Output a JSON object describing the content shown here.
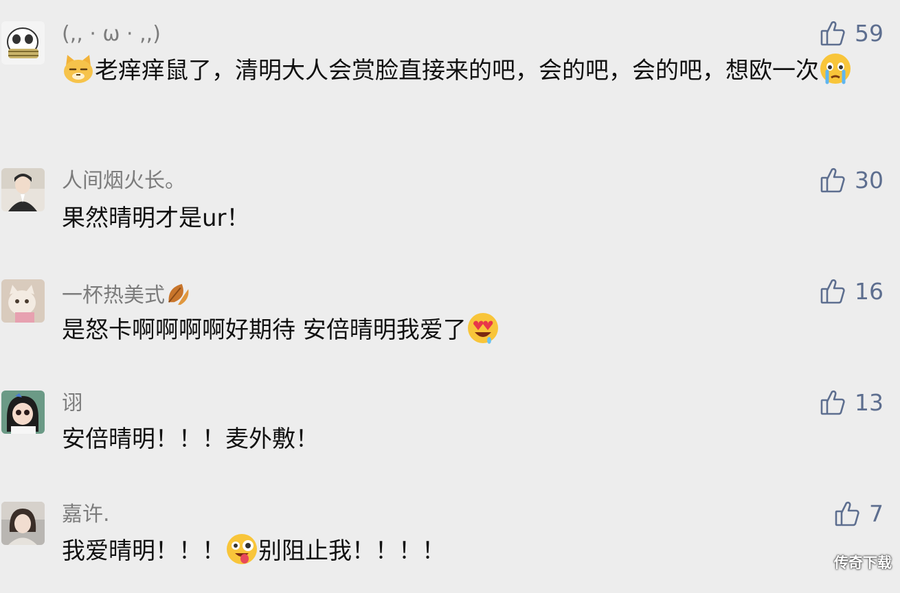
{
  "comments": [
    {
      "username": "(,, · ω · ,,)",
      "text_after_emoji": "老痒痒鼠了，清明大人会赏脸直接来的吧，会的吧，会的吧，想欧一次",
      "likes": "59",
      "leading_emoji": "cat-face-emoji",
      "trailing_emoji": "crying-face-emoji"
    },
    {
      "username": "人间烟火长。",
      "text": "果然晴明才是ur！",
      "likes": "30"
    },
    {
      "username": "一杯热美式",
      "username_emoji": "fallen-leaf-emoji",
      "text": "是怒卡啊啊啊啊好期待 安倍晴明我爱了",
      "likes": "16",
      "trailing_emoji": "heart-eyes-emoji"
    },
    {
      "username": "诩",
      "text": "安倍晴明！！！麦外敷！",
      "likes": "13"
    },
    {
      "username": "嘉许.",
      "text_before_emoji": "我爱晴明！！！",
      "text_after_emoji": "别阻止我！！！！",
      "likes": "7",
      "middle_emoji": "zany-face-emoji"
    }
  ],
  "watermark": "传奇下载",
  "colors": {
    "background": "#ededed",
    "username": "#7c7c7c",
    "text": "#111111",
    "like": "#5d6e8f"
  }
}
